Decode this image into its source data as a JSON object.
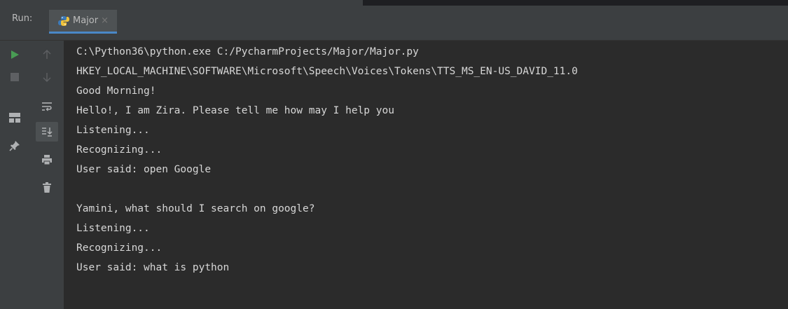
{
  "run_panel": {
    "run_label": "Run:",
    "tab": {
      "label": "Major",
      "close_glyph": "×"
    }
  },
  "toolbar": {
    "left": [
      "run-icon",
      "stop-icon",
      "layout-icon",
      "pin-icon"
    ],
    "right": [
      "up-arrow-icon",
      "down-arrow-icon",
      "soft-wrap-icon",
      "scroll-to-end-icon",
      "print-icon",
      "trash-icon"
    ]
  },
  "console": {
    "lines": [
      "C:\\Python36\\python.exe C:/PycharmProjects/Major/Major.py",
      "HKEY_LOCAL_MACHINE\\SOFTWARE\\Microsoft\\Speech\\Voices\\Tokens\\TTS_MS_EN-US_DAVID_11.0",
      "Good Morning!",
      "Hello!, I am Zira. Please tell me how may I help you",
      "Listening...",
      "Recognizing...",
      "User said: open Google",
      "",
      "Yamini, what should I search on google?",
      "Listening...",
      "Recognizing...",
      "User said: what is python"
    ]
  },
  "colors": {
    "background": "#2b2b2b",
    "panel": "#3c3f41",
    "text": "#d7d7d7",
    "run_green": "#499c54",
    "accent": "#4a88c7"
  }
}
